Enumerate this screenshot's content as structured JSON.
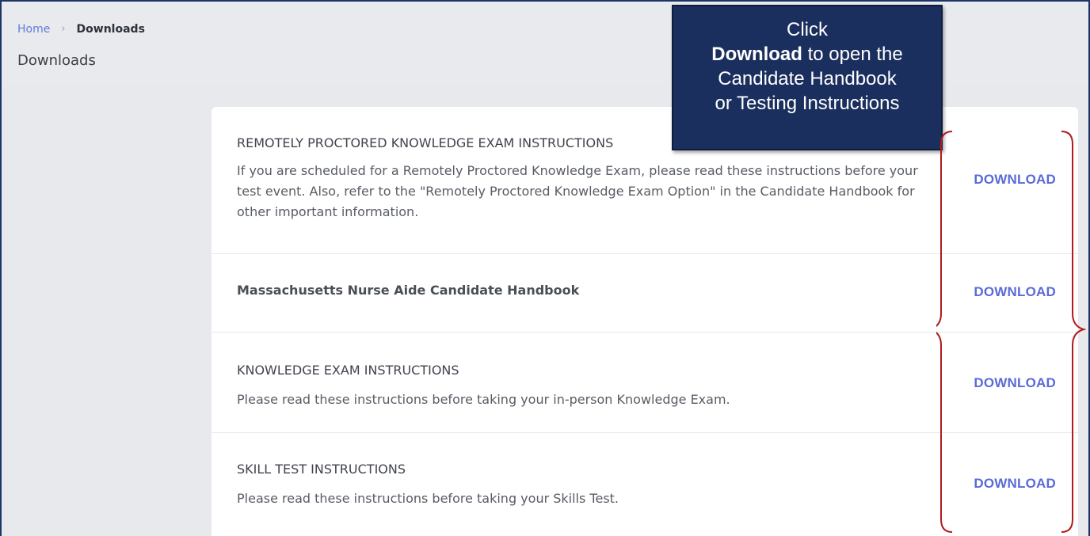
{
  "breadcrumb": {
    "home": "Home",
    "separator": "›",
    "current": "Downloads"
  },
  "page": {
    "title": "Downloads"
  },
  "downloads": [
    {
      "title": "REMOTELY PROCTORED KNOWLEDGE EXAM INSTRUCTIONS",
      "description": "If you are scheduled for a Remotely Proctored Knowledge Exam, please read these instructions before your test event. Also, refer to the \"Remotely Proctored Knowledge Exam Option\" in the Candidate Handbook for other important information.",
      "action": "DOWNLOAD"
    },
    {
      "title": "Massachusetts Nurse Aide Candidate Handbook",
      "description": "",
      "action": "DOWNLOAD"
    },
    {
      "title": "KNOWLEDGE EXAM INSTRUCTIONS",
      "description": "Please read these instructions before taking your in-person Knowledge Exam.",
      "action": "DOWNLOAD"
    },
    {
      "title": "SKILL TEST INSTRUCTIONS",
      "description": "Please read these instructions before taking your Skills Test.",
      "action": "DOWNLOAD"
    }
  ],
  "callout": {
    "line1": "Click",
    "line2_bold": "Download",
    "line2_rest": " to open the",
    "line3": "Candidate Handbook",
    "line4": "or Testing Instructions"
  },
  "colors": {
    "link": "#5a6bd6",
    "callout_bg": "#1b2f5e",
    "brace": "#b01c1c",
    "frame": "#1c3566"
  },
  "icons": {
    "breadcrumb_separator": "chevron-right-icon",
    "annotation": "curly-brace-icon"
  }
}
